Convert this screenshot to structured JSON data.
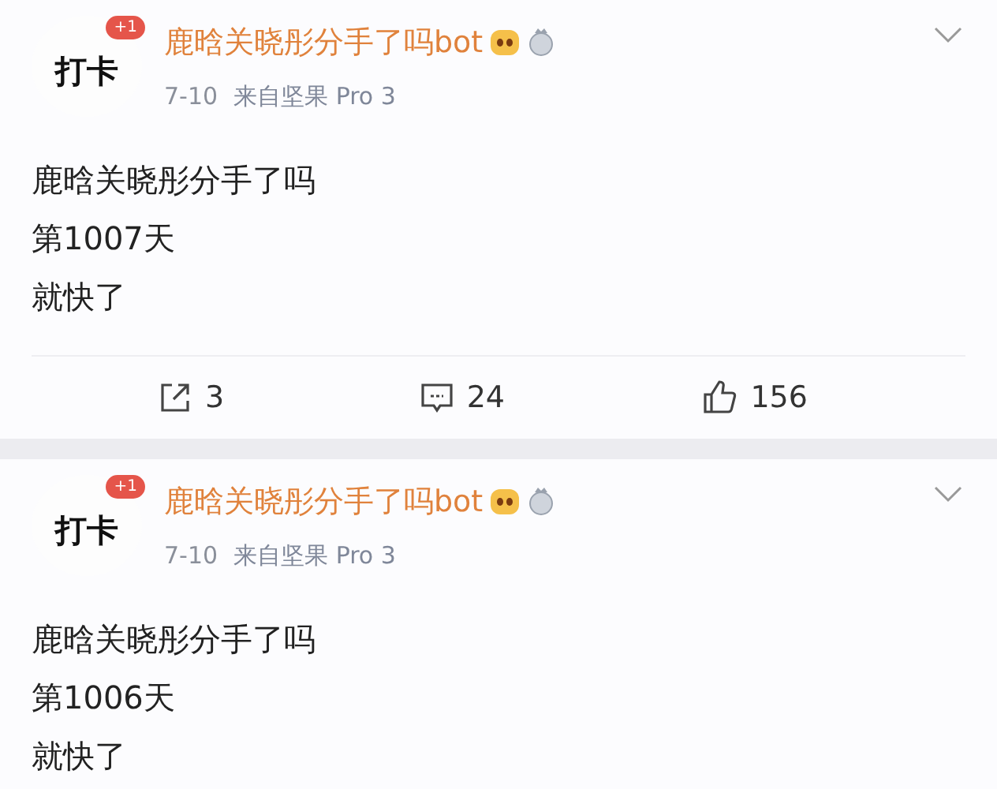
{
  "posts": [
    {
      "avatar": {
        "label": "打卡",
        "badge": "+1"
      },
      "author": "鹿晗关晓彤分手了吗bot",
      "date": "7-10",
      "source": "来自坚果 Pro 3",
      "lines": [
        "鹿晗关晓彤分手了吗",
        "第1007天",
        "就快了"
      ],
      "actions": {
        "reposts": "3",
        "comments": "24",
        "likes": "156"
      }
    },
    {
      "avatar": {
        "label": "打卡",
        "badge": "+1"
      },
      "author": "鹿晗关晓彤分手了吗bot",
      "date": "7-10",
      "source": "来自坚果 Pro 3",
      "lines": [
        "鹿晗关晓彤分手了吗",
        "第1006天",
        "就快了"
      ]
    }
  ]
}
